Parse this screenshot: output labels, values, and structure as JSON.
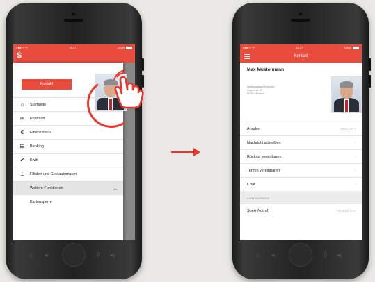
{
  "left_screen": {
    "status": {
      "carrier": "●●●○○ ᯤ",
      "time": "15:27",
      "battery": "100%"
    },
    "logo": "Ṡ",
    "kontakt_button": "Kontakt",
    "menu": [
      {
        "icon": "⌂",
        "label": "Startseite"
      },
      {
        "icon": "✉",
        "label": "Postfach"
      },
      {
        "icon": "€",
        "label": "Finanzstatus"
      },
      {
        "icon": "⊟",
        "label": "Banking"
      },
      {
        "icon": "✔",
        "label": "Kwitt"
      },
      {
        "icon": "⌶",
        "label": "Filialen und Geldautomaten"
      }
    ],
    "weitere": "Weitere Funktionen",
    "kartensperre": "Kartensperre"
  },
  "right_screen": {
    "status": {
      "carrier": "●●●○○ ᯤ",
      "time": "15:27",
      "battery": "100%"
    },
    "title": "Kontakt",
    "name": "Max Mustermann",
    "address": [
      "Stadtsparkasse München",
      "Ungererstr. 75",
      "80805 München"
    ],
    "rows": [
      {
        "label": "Anrufen",
        "value": "089 2167-0"
      },
      {
        "label": "Nachricht schreiben",
        "value": "›"
      },
      {
        "label": "Rückruf vereinbaren",
        "value": "›"
      },
      {
        "label": "Termin vereinbaren",
        "value": "›"
      },
      {
        "label": "Chat",
        "value": "›"
      }
    ],
    "section": "KARTENSPERRE",
    "sperr": {
      "label": "Sperr-Notruf",
      "value": "+49 8921 67-0"
    }
  },
  "colors": {
    "accent": "#e84c3d",
    "background": "#e9e8e4"
  }
}
